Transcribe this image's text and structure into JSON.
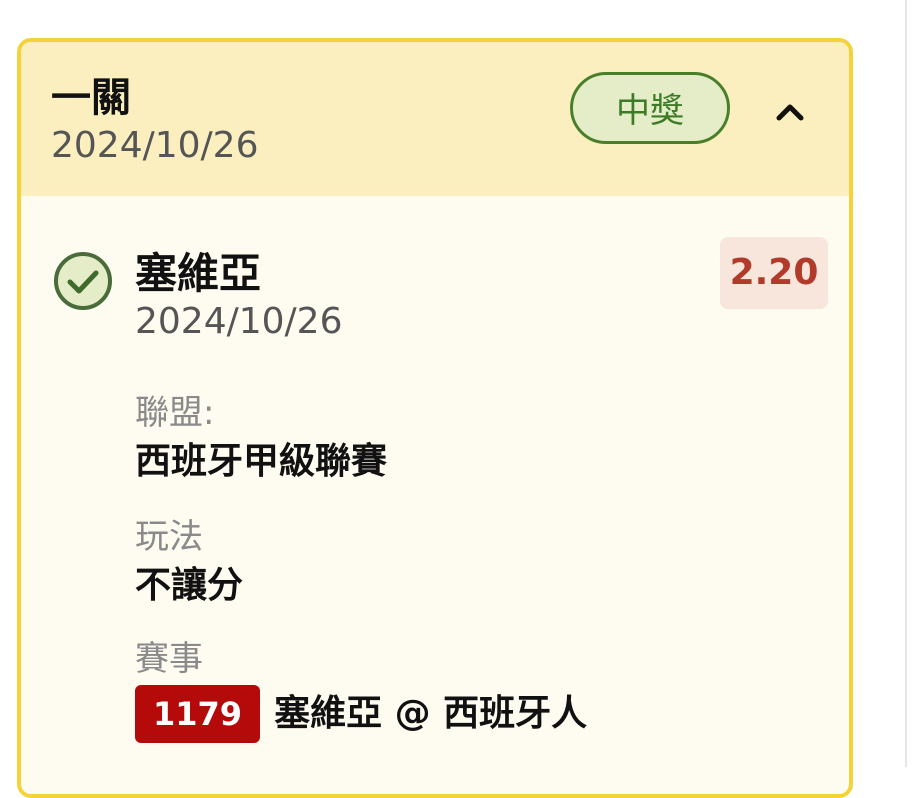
{
  "leg": {
    "type_label": "一關",
    "date": "2024/10/26",
    "status_label": "中獎",
    "colors": {
      "accent_border": "#f4d33a",
      "header_bg": "#fbefc0",
      "win_green": "#3d7b26",
      "odds_red": "#b23a2a",
      "code_red": "#b40a0a"
    }
  },
  "selection": {
    "team": "塞維亞",
    "date": "2024/10/26",
    "odds": "2.20",
    "league_label": "聯盟:",
    "league_value": "西班牙甲級聯賽",
    "play_label": "玩法",
    "play_value": "不讓分",
    "event_label": "賽事",
    "event_code": "1179",
    "event_name": "塞維亞 @ 西班牙人"
  },
  "icons": {
    "collapse": "chevron-up-icon",
    "result": "check-circle-icon"
  }
}
